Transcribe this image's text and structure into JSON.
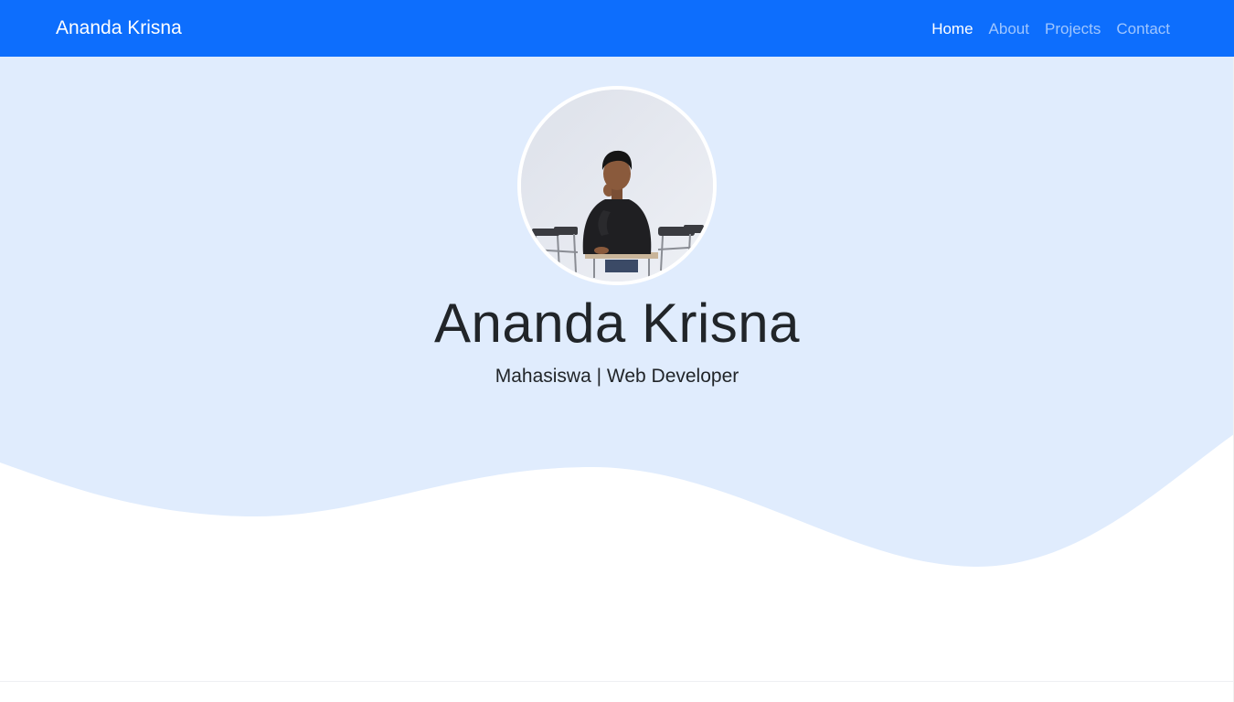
{
  "navbar": {
    "brand": "Ananda Krisna",
    "links": [
      {
        "label": "Home",
        "active": true
      },
      {
        "label": "About",
        "active": false
      },
      {
        "label": "Projects",
        "active": false
      },
      {
        "label": "Contact",
        "active": false
      }
    ]
  },
  "hero": {
    "name": "Ananda Krisna",
    "tagline": "Mahasiswa | Web Developer",
    "profile_image": "profile-photo"
  },
  "colors": {
    "navbar_bg": "#0d6efd",
    "hero_bg": "#e0ecfd",
    "page_bg": "#ffffff"
  }
}
